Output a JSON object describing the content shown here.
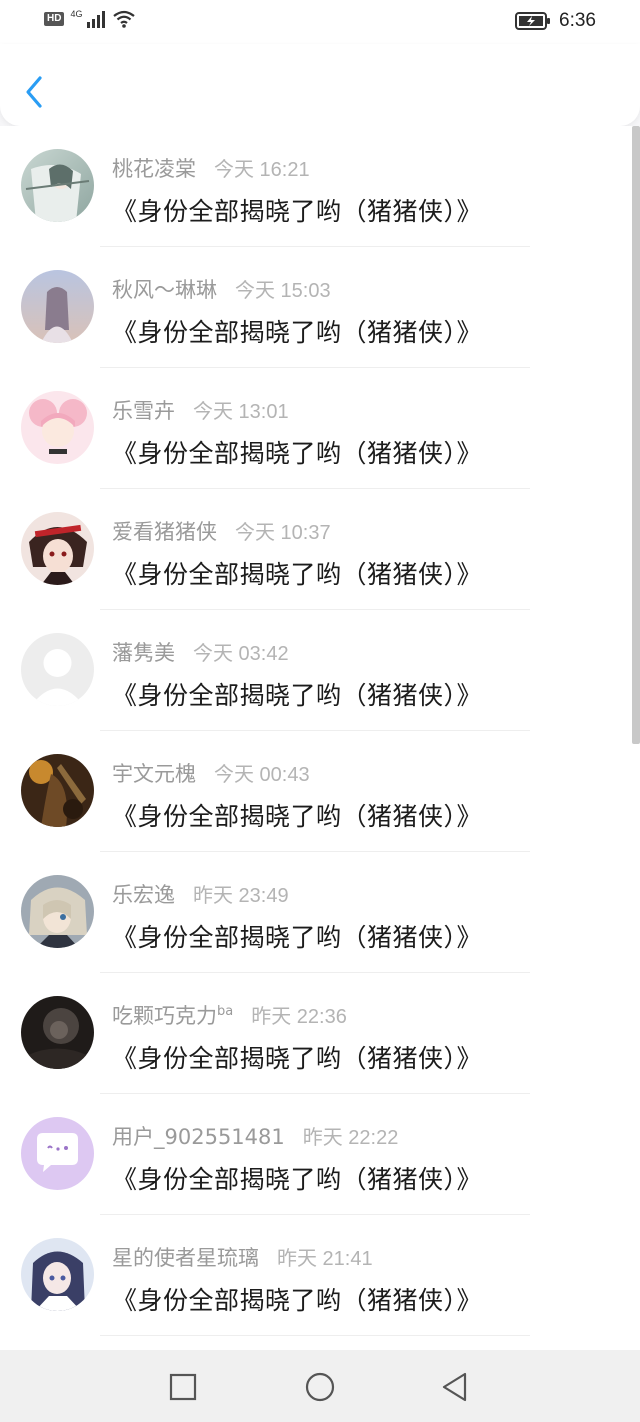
{
  "status_bar": {
    "hd": "HD",
    "network": "4G",
    "time": "6:36"
  },
  "header": {
    "back_icon": "chevron-left-icon",
    "accent_color": "#2a9df4"
  },
  "comments": [
    {
      "user": "桃花凌棠",
      "time": "今天 16:21",
      "message": "《身份全部揭晓了哟（猪猪侠）》",
      "avatar": "anime-avatar-1"
    },
    {
      "user": "秋风～琳琳",
      "time": "今天 15:03",
      "message": "《身份全部揭晓了哟（猪猪侠）》",
      "avatar": "anime-avatar-2"
    },
    {
      "user": "乐雪卉",
      "time": "今天 13:01",
      "message": "《身份全部揭晓了哟（猪猪侠）》",
      "avatar": "anime-avatar-3"
    },
    {
      "user": "爱看猪猪侠",
      "time": "今天 10:37",
      "message": "《身份全部揭晓了哟（猪猪侠）》",
      "avatar": "anime-avatar-4"
    },
    {
      "user": "藩隽美",
      "time": "今天 03:42",
      "message": "《身份全部揭晓了哟（猪猪侠）》",
      "avatar": "default-avatar"
    },
    {
      "user": "宇文元槐",
      "time": "今天 00:43",
      "message": "《身份全部揭晓了哟（猪猪侠）》",
      "avatar": "photo-avatar-5"
    },
    {
      "user": "乐宏逸",
      "time": "昨天 23:49",
      "message": "《身份全部揭晓了哟（猪猪侠）》",
      "avatar": "anime-avatar-6"
    },
    {
      "user": "吃颗巧克力",
      "user_sup": "ba",
      "time": "昨天 22:36",
      "message": "《身份全部揭晓了哟（猪猪侠）》",
      "avatar": "photo-avatar-7"
    },
    {
      "user": "用户_902551481",
      "time": "昨天 22:22",
      "message": "《身份全部揭晓了哟（猪猪侠）》",
      "avatar": "chat-bubble-avatar"
    },
    {
      "user": "星的使者星琉璃",
      "time": "昨天 21:41",
      "message": "《身份全部揭晓了哟（猪猪侠）》",
      "avatar": "anime-avatar-10"
    }
  ],
  "nav_bar": {
    "recents_icon": "square-icon",
    "home_icon": "circle-icon",
    "back_icon": "triangle-back-icon"
  }
}
